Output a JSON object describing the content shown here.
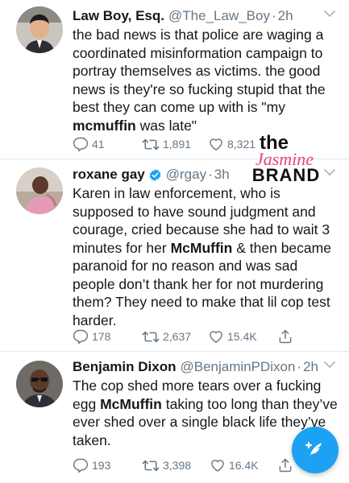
{
  "tweets": [
    {
      "name": "Law Boy, Esq.",
      "handle": "@The_Law_Boy",
      "dot": "·",
      "time": "2h",
      "text_a": "the bad news is that police are waging a coordinated misinformation campaign to portray themselves as victims. the good news is they're so fucking stupid that the best they can come up with is \"my ",
      "text_bold": "mcmuffin",
      "text_b": " was late\"",
      "replies": "41",
      "retweets": "1,891",
      "likes": "8,321"
    },
    {
      "name": "roxane gay",
      "handle": "@rgay",
      "dot": "·",
      "time": "3h",
      "text_a": "Karen in law enforcement, who is supposed to have sound judgment and courage, cried because she had to wait 3 minutes for her ",
      "text_bold": "McMuffin",
      "text_b": " & then became paranoid for no reason and was sad people don’t thank her for not murdering them? They need to make that lil cop test harder.",
      "replies": "178",
      "retweets": "2,637",
      "likes": "15.4K"
    },
    {
      "name": "Benjamin Dixon",
      "handle": "@BenjaminPDixon",
      "dot": "·",
      "time": "2h",
      "text_a": "The cop shed more tears over a fucking egg ",
      "text_bold": "McMuffin",
      "text_b": " taking too long than they’ve ever shed over a single black life they’ve taken.",
      "replies": "193",
      "retweets": "3,398",
      "likes": "16.4K"
    }
  ],
  "watermark": {
    "line1": "the",
    "line2": "Jasmine",
    "line3": "BRAND"
  },
  "icons": {
    "reply": "reply-icon",
    "retweet": "retweet-icon",
    "like": "like-icon",
    "share": "share-icon",
    "verified": "verified-badge-icon",
    "compose": "compose-tweet-icon",
    "more": "chevron-down-icon"
  },
  "colors": {
    "accent": "#1da1f2",
    "text": "#14171a",
    "muted": "#657786",
    "watermark_pink": "#e8457a",
    "divider": "#e1e8ed"
  }
}
